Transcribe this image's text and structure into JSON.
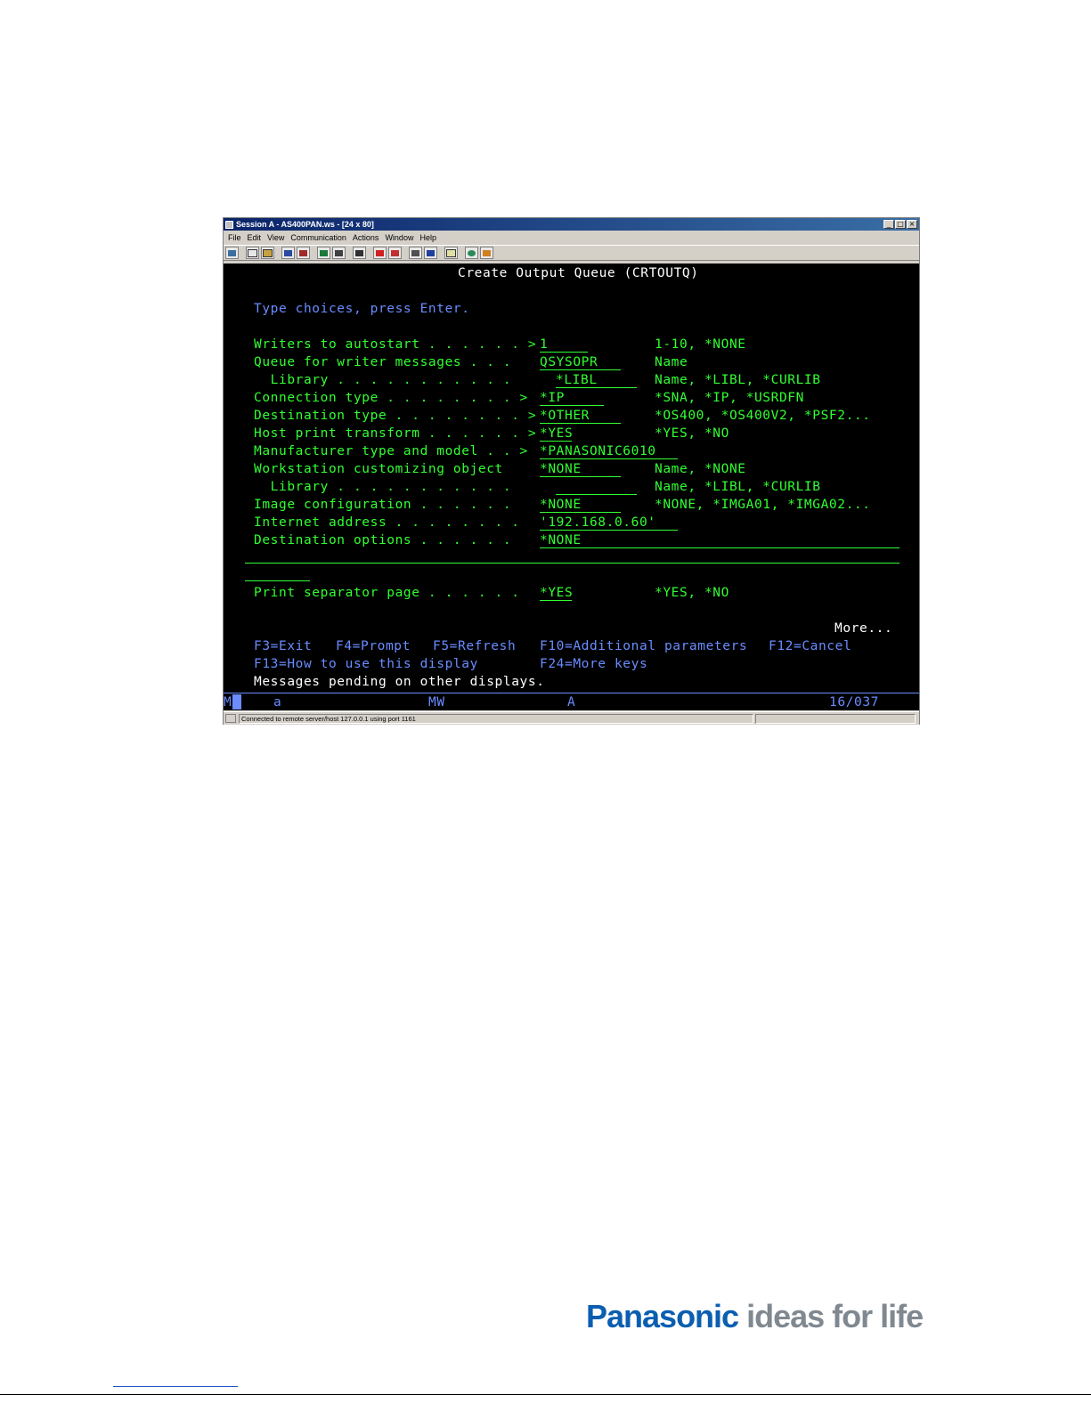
{
  "window": {
    "title": "Session A - AS400PAN.ws - [24 x 80]",
    "minimize": "_",
    "maximize": "□",
    "close": "×"
  },
  "menu": [
    "File",
    "Edit",
    "View",
    "Communication",
    "Actions",
    "Window",
    "Help"
  ],
  "toolbar_icons": [
    "print-screen-icon",
    "copy-icon",
    "paste-icon",
    "send-file-icon",
    "receive-file-icon",
    "display-icon",
    "keyboard-icon",
    "macro-icon",
    "record-icon",
    "stop-icon",
    "play-icon",
    "clear-icon",
    "notepad-icon",
    "globe-icon",
    "support-icon"
  ],
  "screen": {
    "title": "Create Output Queue (CRTOUTQ)",
    "instruction": "Type choices, press Enter.",
    "fields": [
      {
        "label": "Writers to autostart . . . . . . >",
        "value": "1",
        "hint": "1-10, *NONE"
      },
      {
        "label": "Queue for writer messages . . .",
        "value": "QSYSOPR",
        "hint": "Name"
      },
      {
        "label": "  Library . . . . . . . . . . .",
        "value": "*LIBL",
        "hint": "Name, *LIBL, *CURLIB"
      },
      {
        "label": "Connection type . . . . . . . . >",
        "value": "*IP",
        "hint": "*SNA, *IP, *USRDFN"
      },
      {
        "label": "Destination type . . . . . . . . >",
        "value": "*OTHER",
        "hint": "*OS400, *OS400V2, *PSF2..."
      },
      {
        "label": "Host print transform . . . . . . >",
        "value": "*YES",
        "hint": "*YES, *NO"
      },
      {
        "label": "Manufacturer type and model . . >",
        "value": "*PANASONIC6010",
        "hint": ""
      },
      {
        "label": "Workstation customizing object",
        "value": "*NONE",
        "hint": "Name, *NONE"
      },
      {
        "label": "  Library . . . . . . . . . . .",
        "value": "",
        "hint": "Name, *LIBL, *CURLIB"
      },
      {
        "label": "Image configuration . . . . . .",
        "value": "*NONE",
        "hint": "*NONE, *IMGA01, *IMGA02..."
      },
      {
        "label": "Internet address . . . . . . . .",
        "value": "'192.168.0.60'",
        "hint": ""
      },
      {
        "label": "Destination options . . . . . .",
        "value": "*NONE",
        "hint": ""
      }
    ],
    "print_separator": {
      "label": "Print separator page . . . . . .",
      "value": "*YES",
      "hint": "*YES, *NO"
    },
    "more": "More...",
    "fkeys_line1": [
      "F3=Exit",
      "F4=Prompt",
      "F5=Refresh",
      "F10=Additional parameters",
      "F12=Cancel"
    ],
    "fkeys_line2": [
      "F13=How to use this display",
      "F24=More keys"
    ],
    "message": "Messages pending on other displays."
  },
  "oia": {
    "mode": "MA",
    "shift": "a",
    "mw": "MW",
    "a": "A",
    "position": "16/037"
  },
  "statusbar": {
    "text": "Connected to remote server/host 127.0.0.1 using port 1161"
  },
  "logo": {
    "brand": "Panasonic",
    "tagline": " ideas for life"
  },
  "colors": {
    "terminal_bg": "#000000",
    "field_green": "#32ff32",
    "label_blue": "#6a8cff",
    "brand_blue": "#0b5eb0"
  }
}
